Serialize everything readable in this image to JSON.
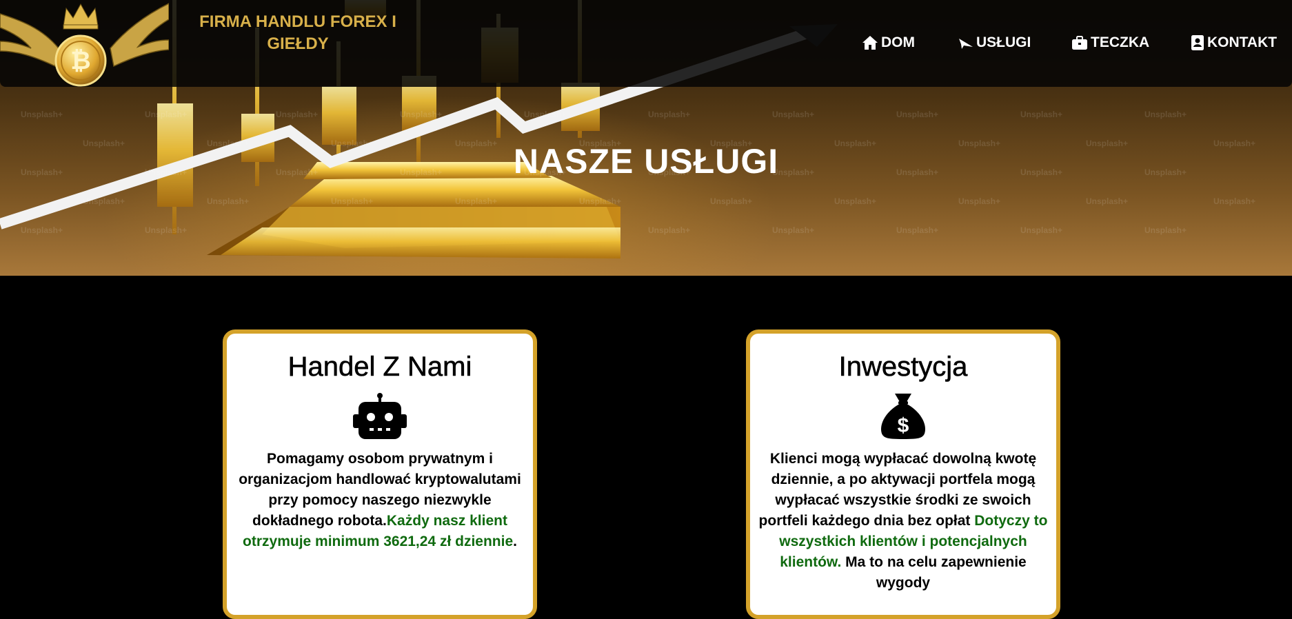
{
  "header": {
    "brand_line1": "FIRMA HANDLU FOREX I",
    "brand_line2": "GIEŁDY",
    "nav": [
      {
        "label": "DOM",
        "icon": "home-icon"
      },
      {
        "label": "USŁUGI",
        "icon": "paper-plane-icon"
      },
      {
        "label": "TECZKA",
        "icon": "briefcase-icon"
      },
      {
        "label": "KONTAKT",
        "icon": "contact-card-icon"
      }
    ]
  },
  "hero": {
    "title": "NASZE USŁUGI",
    "watermark": "Unsplash+"
  },
  "cards": [
    {
      "title": "Handel Z Nami",
      "icon": "robot-icon",
      "text": "Pomagamy osobom prywatnym i organizacjom handlować kryptowalutami przy pomocy naszego niezwykle dokładnego robota.",
      "highlight": "Każdy nasz klient otrzymuje minimum 3621,24 zł dziennie",
      "text_end": "."
    },
    {
      "title": "Inwestycja",
      "icon": "money-bag-icon",
      "text": "Klienci mogą wypłacać dowolną kwotę dziennie, a po aktywacji portfela mogą wypłacać wszystkie środki ze swoich portfeli każdego dnia bez opłat ",
      "highlight": "Dotyczy to wszystkich klientów i potencjalnych klientów.",
      "text_end": " Ma to na celu zapewnienie wygody"
    }
  ],
  "colors": {
    "gold": "#d4a22a",
    "brand_gold": "#d8b04a",
    "highlight_green": "#0f6a0f",
    "background": "#000000"
  }
}
